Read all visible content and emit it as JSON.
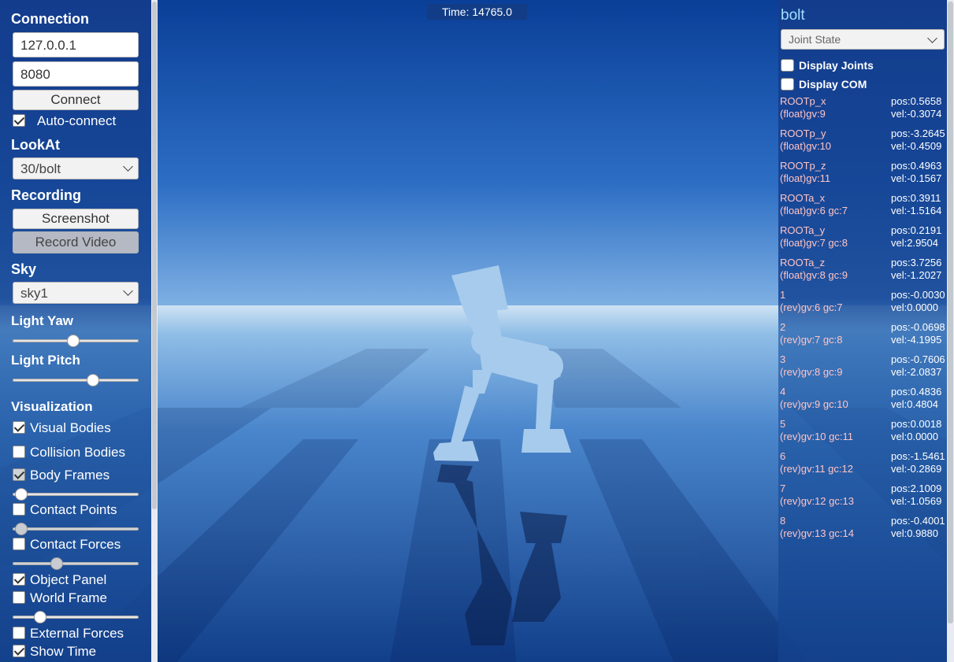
{
  "time": {
    "label": "Time: 14765.0"
  },
  "left_panel": {
    "connection": {
      "title": "Connection",
      "host": "127.0.0.1",
      "port": "8080",
      "connect_label": "Connect",
      "auto_connect_label": "Auto-connect",
      "auto_connect_checked": true
    },
    "lookat": {
      "title": "LookAt",
      "selected": "30/bolt"
    },
    "recording": {
      "title": "Recording",
      "screenshot_label": "Screenshot",
      "record_video_label": "Record Video"
    },
    "sky": {
      "title": "Sky",
      "selected": "sky1"
    },
    "light_yaw": {
      "title": "Light Yaw",
      "value": 0.48
    },
    "light_pitch": {
      "title": "Light Pitch",
      "value": 0.64
    },
    "visualization": {
      "title": "Visualization",
      "visual_bodies": {
        "label": "Visual Bodies",
        "checked": true
      },
      "collision_bodies": {
        "label": "Collision Bodies",
        "checked": false
      },
      "body_frames": {
        "label": "Body Frames",
        "checked": true,
        "slider": 0.07
      },
      "contact_points": {
        "label": "Contact Points",
        "checked": false,
        "slider": 0.07
      },
      "contact_forces": {
        "label": "Contact Forces",
        "checked": false,
        "slider": 0.35
      },
      "object_panel": {
        "label": "Object Panel",
        "checked": true
      },
      "world_frame": {
        "label": "World Frame",
        "checked": false,
        "slider": 0.22
      },
      "external_forces": {
        "label": "External Forces",
        "checked": false
      },
      "show_time": {
        "label": "Show Time",
        "checked": true
      }
    }
  },
  "right_panel": {
    "object_name": "bolt",
    "mode": "Joint State",
    "display_joints_label": "Display Joints",
    "display_com_label": "Display COM",
    "joints": [
      {
        "name": "ROOTp_x",
        "idx": "(float)gv:9",
        "pos": "pos:0.5658",
        "vel": "vel:-0.3074"
      },
      {
        "name": "ROOTp_y",
        "idx": "(float)gv:10",
        "pos": "pos:-3.2645",
        "vel": "vel:-0.4509"
      },
      {
        "name": "ROOTp_z",
        "idx": "(float)gv:11",
        "pos": "pos:0.4963",
        "vel": "vel:-0.1567"
      },
      {
        "name": "ROOTa_x",
        "idx": "(float)gv:6 gc:7",
        "pos": "pos:0.3911",
        "vel": "vel:-1.5164"
      },
      {
        "name": "ROOTa_y",
        "idx": "(float)gv:7 gc:8",
        "pos": "pos:0.2191",
        "vel": "vel:2.9504"
      },
      {
        "name": "ROOTa_z",
        "idx": "(float)gv:8 gc:9",
        "pos": "pos:3.7256",
        "vel": "vel:-1.2027"
      },
      {
        "name": "1",
        "idx": "(rev)gv:6 gc:7",
        "pos": "pos:-0.0030",
        "vel": "vel:0.0000"
      },
      {
        "name": "2",
        "idx": "(rev)gv:7 gc:8",
        "pos": "pos:-0.0698",
        "vel": "vel:-4.1995"
      },
      {
        "name": "3",
        "idx": "(rev)gv:8 gc:9",
        "pos": "pos:-0.7606",
        "vel": "vel:-2.0837"
      },
      {
        "name": "4",
        "idx": "(rev)gv:9 gc:10",
        "pos": "pos:0.4836",
        "vel": "vel:0.4804"
      },
      {
        "name": "5",
        "idx": "(rev)gv:10 gc:11",
        "pos": "pos:0.0018",
        "vel": "vel:0.0000"
      },
      {
        "name": "6",
        "idx": "(rev)gv:11 gc:12",
        "pos": "pos:-1.5461",
        "vel": "vel:-0.2869"
      },
      {
        "name": "7",
        "idx": "(rev)gv:12 gc:13",
        "pos": "pos:2.1009",
        "vel": "vel:-1.0569"
      },
      {
        "name": "8",
        "idx": "(rev)gv:13 gc:14",
        "pos": "pos:-0.4001",
        "vel": "vel:0.9880"
      }
    ]
  }
}
